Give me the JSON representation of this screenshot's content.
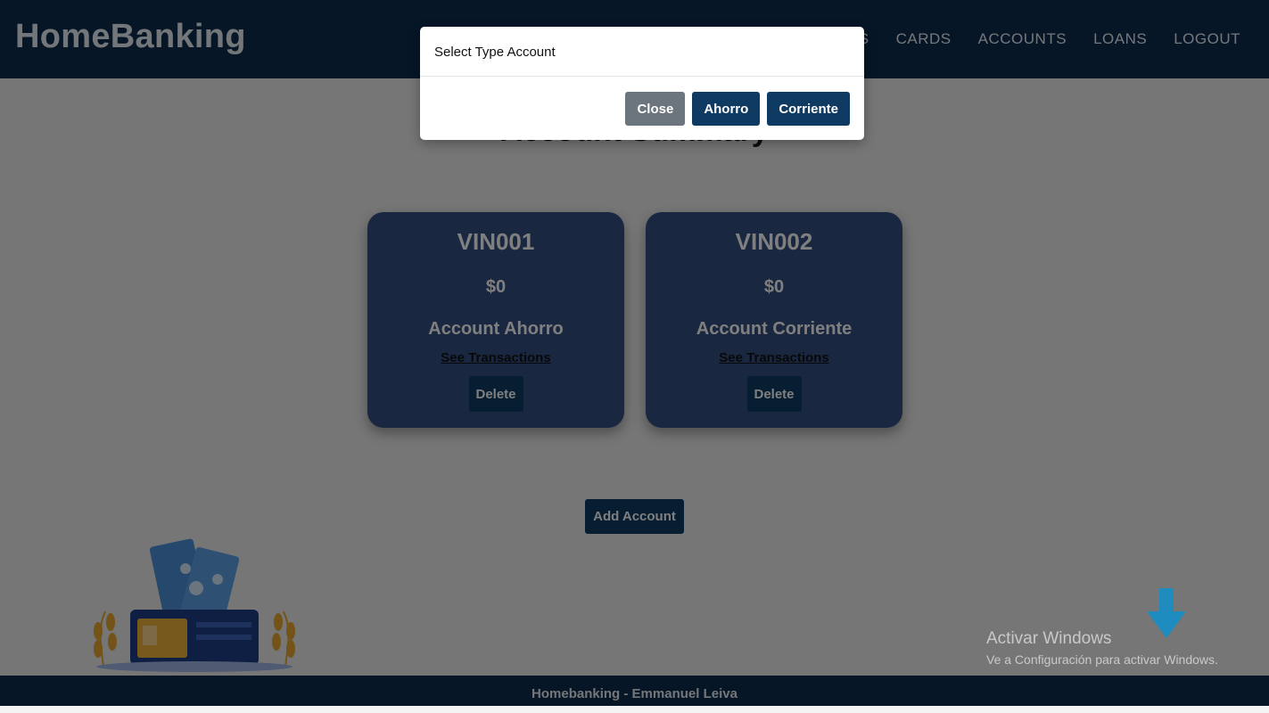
{
  "navbar": {
    "brand": "HomeBanking",
    "links": [
      "S",
      "CARDS",
      "ACCOUNTS",
      "LOANS",
      "LOGOUT"
    ]
  },
  "main": {
    "title": "Account Summary",
    "accounts": [
      {
        "number": "VIN001",
        "balance": "$0",
        "type": "Account Ahorro",
        "link_label": "See Transactions",
        "delete_label": "Delete"
      },
      {
        "number": "VIN002",
        "balance": "$0",
        "type": "Account Corriente",
        "link_label": "See Transactions",
        "delete_label": "Delete"
      }
    ],
    "add_label": "Add Account"
  },
  "footer": {
    "text": "Homebanking - Emmanuel Leiva"
  },
  "modal": {
    "title": "Select Type Account",
    "buttons": {
      "close": "Close",
      "ahorro": "Ahorro",
      "corriente": "Corriente"
    }
  },
  "watermark": {
    "title": "Activar Windows",
    "subtitle": "Ve a Configuración para activar Windows."
  },
  "colors": {
    "navbar": "#0c2d4f",
    "card": "#324f80",
    "primary_button": "#0f3a62",
    "close_button": "#6c757d"
  }
}
